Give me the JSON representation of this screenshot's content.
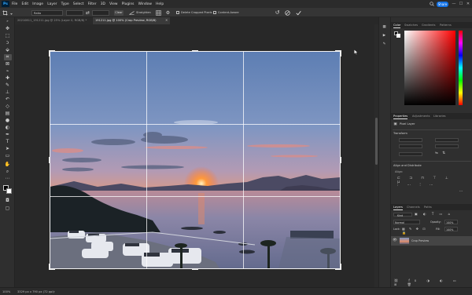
{
  "app": {
    "logo_text": "Ps"
  },
  "menu": [
    "File",
    "Edit",
    "Image",
    "Layer",
    "Type",
    "Select",
    "Filter",
    "3D",
    "View",
    "Plugins",
    "Window",
    "Help"
  ],
  "header": {
    "share_label": "Share",
    "search_icon": "search-icon",
    "win_controls": [
      "—",
      "☐",
      "✕"
    ]
  },
  "options_bar": {
    "ratio_value": "Ratio",
    "swap_icon": "swap-icon",
    "clear_label": "Clear",
    "straighten_label": "Straighten",
    "delete_cropped_label": "Delete Cropped Pixels",
    "content_aware_label": "Content-Aware",
    "reset_icon": "reset-icon",
    "cancel_icon": "cancel-icon",
    "commit_icon": "commit-icon"
  },
  "tabs": [
    {
      "label": "20210811_191211.jpg @ 25% (Layer 0, RGB/8) *",
      "active": false
    },
    {
      "label": "191211.jpg @ 100% (Crop Preview, RGB/8)",
      "active": true
    }
  ],
  "panels": {
    "color_tabs": [
      "Color",
      "Swatches",
      "Gradients",
      "Patterns"
    ],
    "properties_tabs": [
      "Properties",
      "Adjustments",
      "Libraries"
    ],
    "pixel_layer_label": "Pixel Layer",
    "transform_label": "Transform",
    "align_label": "Align and Distribute",
    "align_sub": "Align:",
    "layers_tabs": [
      "Layers",
      "Channels",
      "Paths"
    ],
    "kind_label": "Kind",
    "blend_mode": "Normal",
    "opacity_label": "Opacity:",
    "opacity_value": "100%",
    "lock_label": "Lock:",
    "fill_label": "Fill:",
    "fill_value": "100%",
    "layer_name": "Crop Preview"
  },
  "status": {
    "zoom": "100%",
    "dims": "3329 px x 790 px (72 ppi)"
  },
  "colors": {
    "accent": "#1473e6",
    "sky_top": "#6f8fc0",
    "sunset": "#e8743a"
  }
}
